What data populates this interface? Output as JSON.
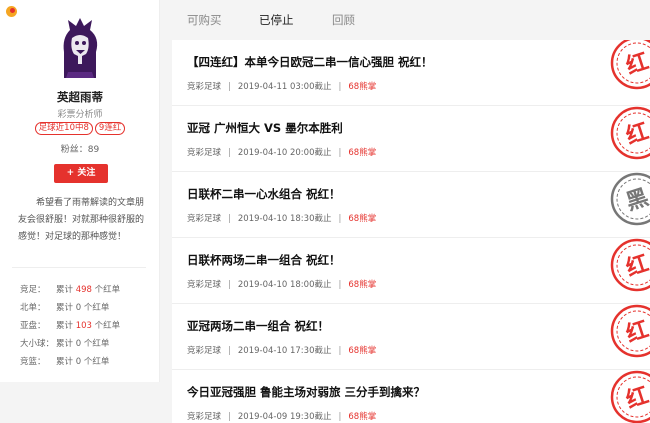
{
  "colors": {
    "accent": "#e5322d",
    "win_stamp": "#e5322d",
    "loss_stamp": "#777777",
    "brand_purple": "#3d185b"
  },
  "profile": {
    "name": "英超雨蒂",
    "role": "彩票分析师",
    "badges": [
      "足球近10中8",
      "9连红"
    ],
    "fans": "粉丝：89",
    "follow_label": "+ 关注",
    "bio": "希望看了雨蒂解读的文章朋友会很舒服！对就那种很舒服的感觉！对足球的那种感觉！",
    "stats": [
      {
        "label": "竞足：",
        "prefix": "累计",
        "count": "498",
        "suffix": "个红单",
        "highlight": true
      },
      {
        "label": "北单：",
        "prefix": "累计",
        "count": "0",
        "suffix": "个红单",
        "highlight": false
      },
      {
        "label": "亚盘：",
        "prefix": "累计",
        "count": "103",
        "suffix": "个红单",
        "highlight": true
      },
      {
        "label": "大小球：",
        "prefix": "累计",
        "count": "0",
        "suffix": "个红单",
        "highlight": false
      },
      {
        "label": "竞篮：",
        "prefix": "累计",
        "count": "0",
        "suffix": "个红单",
        "highlight": false
      }
    ]
  },
  "tabs": [
    "可购买",
    "已停止",
    "回顾"
  ],
  "active_tab": "已停止",
  "articles": [
    {
      "title": "【四连红】本单今日欧冠二串一信心强胆 祝红！",
      "category": "竞彩足球",
      "deadline": "2019-04-11 03:00截止",
      "price": "68熊掌",
      "result": "红",
      "result_icon": "red-stamp-icon"
    },
    {
      "title": "亚冠 广州恒大 VS 墨尔本胜利",
      "category": "竞彩足球",
      "deadline": "2019-04-10 20:00截止",
      "price": "68熊掌",
      "result": "红",
      "result_icon": "red-stamp-icon"
    },
    {
      "title": "日联杯二串一心水组合 祝红！",
      "category": "竞彩足球",
      "deadline": "2019-04-10 18:30截止",
      "price": "68熊掌",
      "result": "黑",
      "result_icon": "black-stamp-icon"
    },
    {
      "title": "日联杯两场二串一组合 祝红！",
      "category": "竞彩足球",
      "deadline": "2019-04-10 18:00截止",
      "price": "68熊掌",
      "result": "红",
      "result_icon": "red-stamp-icon"
    },
    {
      "title": "亚冠两场二串一组合 祝红！",
      "category": "竞彩足球",
      "deadline": "2019-04-10 17:30截止",
      "price": "68熊掌",
      "result": "红",
      "result_icon": "red-stamp-icon"
    },
    {
      "title": "今日亚冠强胆 鲁能主场对弱旅 三分手到擒来？",
      "category": "竞彩足球",
      "deadline": "2019-04-09 19:30截止",
      "price": "68熊掌",
      "result": "红",
      "result_icon": "red-stamp-icon"
    }
  ]
}
